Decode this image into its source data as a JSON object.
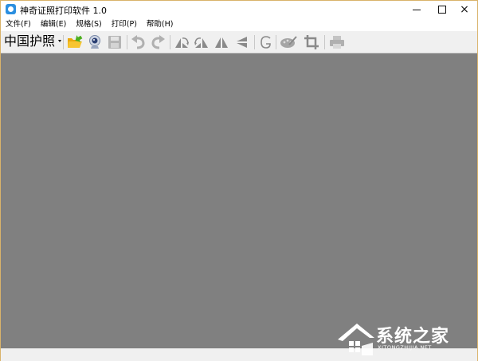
{
  "window": {
    "title": "神奇证照打印软件 1.0",
    "controls": {
      "minimize": "minimize-icon",
      "maximize": "maximize-icon",
      "close": "×"
    }
  },
  "menu": [
    {
      "label": "文件(F)"
    },
    {
      "label": "编辑(E)"
    },
    {
      "label": "规格(S)"
    },
    {
      "label": "打印(P)"
    },
    {
      "label": "帮助(H)"
    }
  ],
  "toolbar": {
    "spec_value": "中国护照",
    "buttons": [
      {
        "name": "open-folder-icon"
      },
      {
        "name": "camera-icon"
      },
      {
        "name": "save-icon"
      },
      {
        "name": "undo-icon"
      },
      {
        "name": "redo-icon"
      },
      {
        "name": "rotate-left-icon"
      },
      {
        "name": "rotate-right-icon"
      },
      {
        "name": "flip-horizontal-icon"
      },
      {
        "name": "flip-vertical-icon"
      },
      {
        "name": "g-icon"
      },
      {
        "name": "palette-icon"
      },
      {
        "name": "crop-icon"
      },
      {
        "name": "printer-icon"
      }
    ]
  },
  "watermark": {
    "title": "系统之家",
    "subtitle": "XITONGZHIJIA.NET"
  },
  "colors": {
    "canvas": "#808080",
    "folder": "#f2b417",
    "arrow_green": "#4caf1f",
    "disabled_icon": "#a8a8a8",
    "active_icon": "#8a8a8a"
  }
}
